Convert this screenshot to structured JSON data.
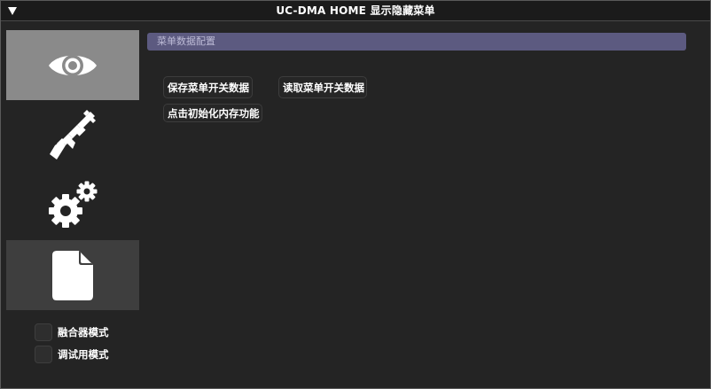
{
  "window": {
    "title": "UC-DMA HOME 显示隐藏菜单"
  },
  "titlebar": {
    "collapse_icon": "triangle-down-icon"
  },
  "sidebar": {
    "items": [
      {
        "name": "visuals",
        "icon": "eye-icon",
        "active": true
      },
      {
        "name": "weapons",
        "icon": "rifle-icon",
        "active": false
      },
      {
        "name": "settings",
        "icon": "gears-icon",
        "active": false
      },
      {
        "name": "config",
        "icon": "file-icon",
        "active": true
      }
    ],
    "options": [
      {
        "label": "融合器模式",
        "checked": false
      },
      {
        "label": "调试用模式",
        "checked": false
      }
    ]
  },
  "main": {
    "section_header": "菜单数据配置",
    "buttons": {
      "save": "保存菜单开关数据",
      "load": "读取菜单开关数据",
      "init": "点击初始化内存功能"
    }
  },
  "colors": {
    "background": "#242424",
    "header_accent": "#5c5a80",
    "active_item": "#8a8a8a",
    "selected_item": "#3e3e3e"
  }
}
